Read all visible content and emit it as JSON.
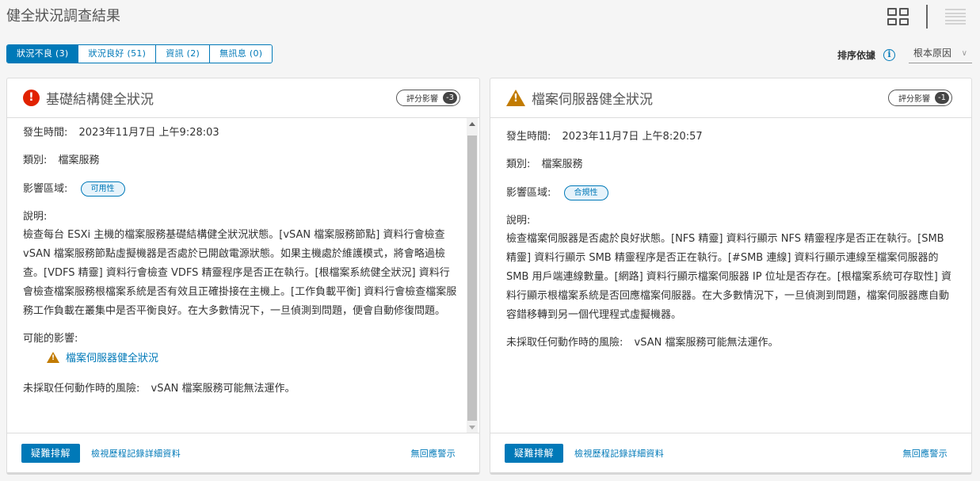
{
  "page_title": "健全狀況調查結果",
  "tabs": [
    {
      "label": "狀況不良 (3)",
      "active": true
    },
    {
      "label": "狀況良好 (51)",
      "active": false
    },
    {
      "label": "資訊 (2)",
      "active": false
    },
    {
      "label": "無訊息 (0)",
      "active": false
    }
  ],
  "sort": {
    "label": "排序依據",
    "value": "根本原因"
  },
  "cards": [
    {
      "title": "基礎結構健全狀況",
      "severity_icon": "error-icon",
      "impact_label": "評分影響",
      "impact_value": "-3",
      "occurred_label": "發生時間:",
      "occurred_value": "2023年11月7日 上午9:28:03",
      "category_label": "類別:",
      "category_value": "檔案服務",
      "area_label": "影響區域:",
      "area_value": "可用性",
      "desc_label": "說明:",
      "description": "檢查每台 ESXi 主機的檔案服務基礎結構健全狀況狀態。[vSAN 檔案服務節點] 資料行會檢查 vSAN 檔案服務節點虛擬機器是否處於已開啟電源狀態。如果主機處於維護模式，將會略過檢查。[VDFS 精靈] 資料行會檢查 VDFS 精靈程序是否正在執行。[根檔案系統健全狀況] 資料行會檢查檔案服務根檔案系統是否有效且正確掛接在主機上。[工作負載平衡] 資料行會檢查檔案服務工作負載在叢集中是否平衡良好。在大多數情況下，一旦偵測到問題，便會自動修復問題。",
      "possible_impact_label": "可能的影響:",
      "possible_impact_link": "檔案伺服器健全狀況",
      "risk_label": "未採取任何動作時的風險:",
      "risk_value": "vSAN 檔案服務可能無法運作。",
      "troubleshoot_label": "疑難排解",
      "history_link": "檢視歷程記錄詳細資料",
      "silence_link": "無回應警示"
    },
    {
      "title": "檔案伺服器健全狀況",
      "severity_icon": "warning-icon",
      "impact_label": "評分影響",
      "impact_value": "-1",
      "occurred_label": "發生時間:",
      "occurred_value": "2023年11月7日 上午8:20:57",
      "category_label": "類別:",
      "category_value": "檔案服務",
      "area_label": "影響區域:",
      "area_value": "合規性",
      "desc_label": "說明:",
      "description": "檢查檔案伺服器是否處於良好狀態。[NFS 精靈] 資料行顯示 NFS 精靈程序是否正在執行。[SMB 精靈] 資料行顯示 SMB 精靈程序是否正在執行。[#SMB 連線] 資料行顯示連線至檔案伺服器的 SMB 用戶端連線數量。[網路] 資料行顯示檔案伺服器 IP 位址是否存在。[根檔案系統可存取性] 資料行顯示根檔案系統是否回應檔案伺服器。在大多數情況下，一旦偵測到問題，檔案伺服器應自動容錯移轉到另一個代理程式虛擬機器。",
      "risk_label": "未採取任何動作時的風險:",
      "risk_value": "vSAN 檔案服務可能無法運作。",
      "troubleshoot_label": "疑難排解",
      "history_link": "檢視歷程記錄詳細資料",
      "silence_link": "無回應警示"
    }
  ],
  "colors": {
    "accent": "#0079b8",
    "error": "#e12200",
    "warning": "#c27b00"
  }
}
